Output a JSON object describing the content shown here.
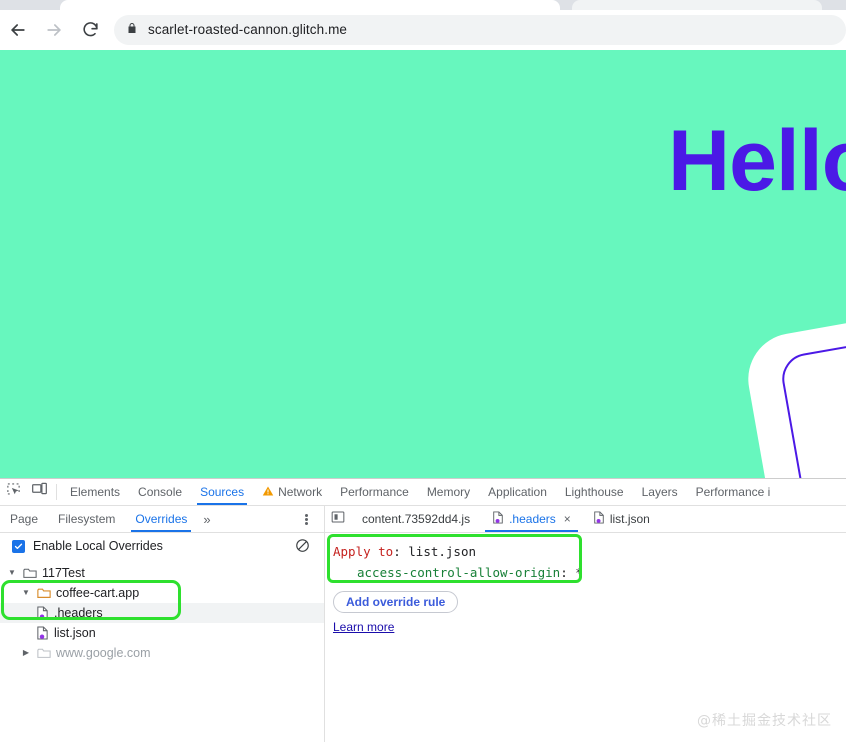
{
  "browser": {
    "back_icon": "arrow-left-icon",
    "forward_icon": "arrow-right-icon",
    "reload_icon": "reload-icon",
    "lock_icon": "lock-icon",
    "url": "scarlet-roasted-cannon.glitch.me"
  },
  "page": {
    "heading": "Hello",
    "bg_color": "#67f7be",
    "heading_color": "#4b19e6"
  },
  "devtools": {
    "inspect_icon": "inspect-element-icon",
    "device_icon": "device-toolbar-icon",
    "tabs": [
      {
        "label": "Elements",
        "active": false,
        "warn": false
      },
      {
        "label": "Console",
        "active": false,
        "warn": false
      },
      {
        "label": "Sources",
        "active": true,
        "warn": false
      },
      {
        "label": "Network",
        "active": false,
        "warn": true
      },
      {
        "label": "Performance",
        "active": false,
        "warn": false
      },
      {
        "label": "Memory",
        "active": false,
        "warn": false
      },
      {
        "label": "Application",
        "active": false,
        "warn": false
      },
      {
        "label": "Lighthouse",
        "active": false,
        "warn": false
      },
      {
        "label": "Layers",
        "active": false,
        "warn": false
      },
      {
        "label": "Performance i",
        "active": false,
        "warn": false
      }
    ],
    "navigator": {
      "subtabs": [
        {
          "label": "Page",
          "active": false
        },
        {
          "label": "Filesystem",
          "active": false
        },
        {
          "label": "Overrides",
          "active": true
        }
      ],
      "more_tabs_icon": "chevron-double-right-icon",
      "menu_icon": "kebab-menu-icon",
      "overrides_checkbox_label": "Enable Local Overrides",
      "overrides_checkbox_checked": true,
      "clear_icon": "clear-overrides-icon",
      "tree": [
        {
          "label": "117Test",
          "type": "folder",
          "depth": 0,
          "expanded": true,
          "dim": false,
          "selected": false
        },
        {
          "label": "coffee-cart.app",
          "type": "folder-override",
          "depth": 1,
          "expanded": true,
          "dim": false,
          "selected": false
        },
        {
          "label": ".headers",
          "type": "file",
          "depth": 2,
          "expanded": null,
          "dim": false,
          "selected": true
        },
        {
          "label": "list.json",
          "type": "file",
          "depth": 2,
          "expanded": null,
          "dim": false,
          "selected": false
        },
        {
          "label": "www.google.com",
          "type": "folder",
          "depth": 1,
          "expanded": false,
          "dim": true,
          "selected": false
        }
      ]
    },
    "editor": {
      "panel_toggle_icon": "show-navigator-icon",
      "tabs": [
        {
          "label": "content.73592dd4.js",
          "active": false,
          "has_icon": false,
          "closable": false
        },
        {
          "label": ".headers",
          "active": true,
          "has_icon": true,
          "closable": true
        },
        {
          "label": "list.json",
          "active": false,
          "has_icon": true,
          "closable": false
        }
      ],
      "close_glyph": "×",
      "header_rule": {
        "apply_key": "Apply to",
        "colon": ":",
        "apply_value": "list.json",
        "header_name": "access-control-allow-origin",
        "header_value": "*"
      },
      "add_rule_label": "Add override rule",
      "learn_more_label": "Learn more"
    }
  },
  "watermark": "@稀土掘金技术社区",
  "highlights": {
    "accent_green": "#2ee02e"
  }
}
